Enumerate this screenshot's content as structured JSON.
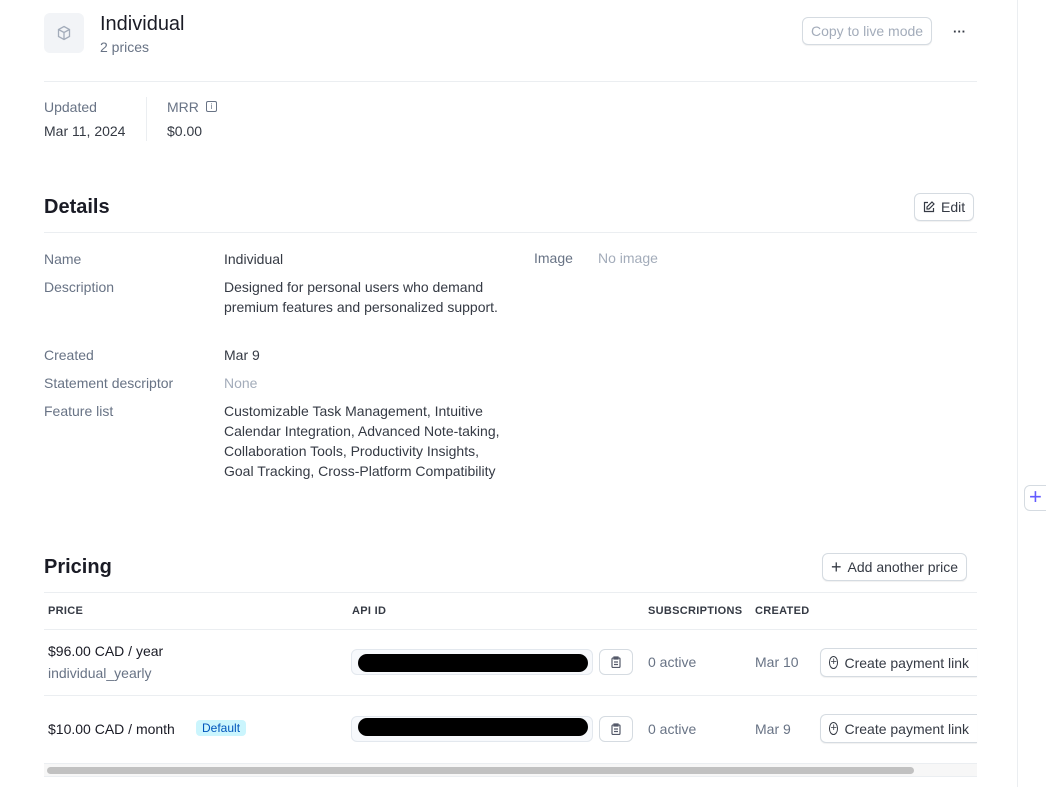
{
  "header": {
    "title": "Individual",
    "subtitle": "2 prices",
    "copy_live_label": "Copy to live mode",
    "more_label": "···"
  },
  "stats": [
    {
      "label": "Updated",
      "value": "Mar 11, 2024"
    },
    {
      "label": "MRR",
      "value": "$0.00"
    }
  ],
  "details": {
    "title": "Details",
    "edit_label": "Edit",
    "rows": [
      {
        "label": "Name",
        "value": "Individual"
      },
      {
        "label": "Description",
        "value": "Designed for personal users who demand premium features and personalized support."
      },
      {
        "label": "Created",
        "value": "Mar 9"
      },
      {
        "label": "Statement descriptor",
        "value": "None"
      },
      {
        "label": "Feature list",
        "value": "Customizable Task Management, Intuitive Calendar Integration, Advanced Note-taking, Collaboration Tools, Productivity Insights, Goal Tracking, Cross-Platform Compatibility"
      }
    ],
    "image_label": "Image",
    "image_value": "No image"
  },
  "pricing": {
    "title": "Pricing",
    "add_label": "Add another price",
    "columns": [
      "PRICE",
      "API ID",
      "SUBSCRIPTIONS",
      "CREATED"
    ],
    "rows": [
      {
        "price": "$96.00 CAD / year",
        "nickname": "individual_yearly",
        "badge": "",
        "subscriptions": "0 active",
        "created": "Mar 10",
        "action": "Create payment link"
      },
      {
        "price": "$10.00 CAD / month",
        "nickname": "",
        "badge": "Default",
        "subscriptions": "0 active",
        "created": "Mar 9",
        "action": "Create payment link"
      }
    ]
  },
  "colors": {
    "accent": "#635bff",
    "badge_bg": "#cbf5fd",
    "badge_text": "#0055bc"
  }
}
